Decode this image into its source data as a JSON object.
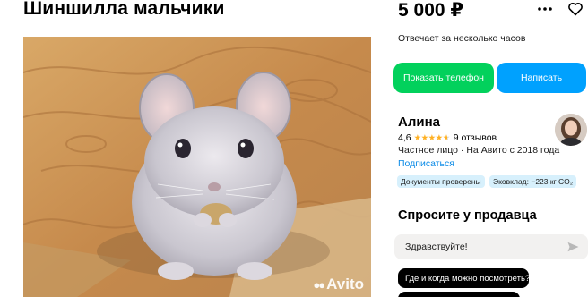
{
  "listing": {
    "title": "Шиншилла мальчики",
    "price": "5 000 ₽",
    "response_time": "Отвечает за несколько часов",
    "photo": {
      "watermark": "Avito"
    }
  },
  "actions": {
    "show_phone": "Показать телефон",
    "write": "Написать"
  },
  "seller": {
    "name": "Алина",
    "rating": "4,6",
    "stars_filled": 4.6,
    "reviews": "9 отзывов",
    "meta": "Частное лицо · На Авито с 2018 года",
    "subscribe": "Подписаться",
    "badges": {
      "docs": "Документы проверены",
      "eco": "Эковклад: −223 кг CO₂"
    }
  },
  "ask": {
    "title": "Спросите у продавца",
    "input_value": "Здравствуйте!",
    "suggestions": [
      "Где и когда можно посмотреть?",
      ""
    ]
  },
  "icons": {
    "more": "more-dots-icon",
    "favorite": "heart-icon",
    "send": "send-icon"
  },
  "colors": {
    "phone_button": "#02d15c",
    "write_button": "#00a1fe",
    "link": "#0a8ae6",
    "stars": "#ffb021",
    "badge_bg": "#d7f0fc"
  }
}
